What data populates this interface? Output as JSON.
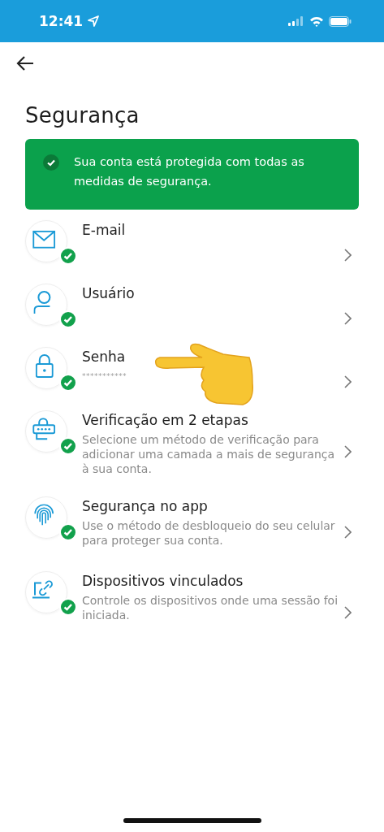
{
  "status_bar": {
    "time": "12:41"
  },
  "header": {
    "title": "Segurança"
  },
  "banner": {
    "text": "Sua conta está protegida com todas as medidas de segurança.",
    "verified": true
  },
  "items": [
    {
      "kind": "email",
      "title": "E-mail",
      "verified": true
    },
    {
      "kind": "user",
      "title": "Usuário",
      "verified": true
    },
    {
      "kind": "lock",
      "title": "Senha",
      "subtitle": "***********",
      "verified": true
    },
    {
      "kind": "keypad",
      "title": "Verificação em 2 etapas",
      "subtitle": "Selecione um método de verificação para adicionar uma camada a mais de segurança à sua conta.",
      "verified": true
    },
    {
      "kind": "fingerprint",
      "title": "Segurança no app",
      "subtitle": "Use o método de desbloqueio do seu celular para proteger sua conta.",
      "verified": true
    },
    {
      "kind": "device",
      "title": "Dispositivos vinculados",
      "subtitle": "Controle os dispositivos onde uma sessão foi iniciada.",
      "verified": true
    }
  ]
}
